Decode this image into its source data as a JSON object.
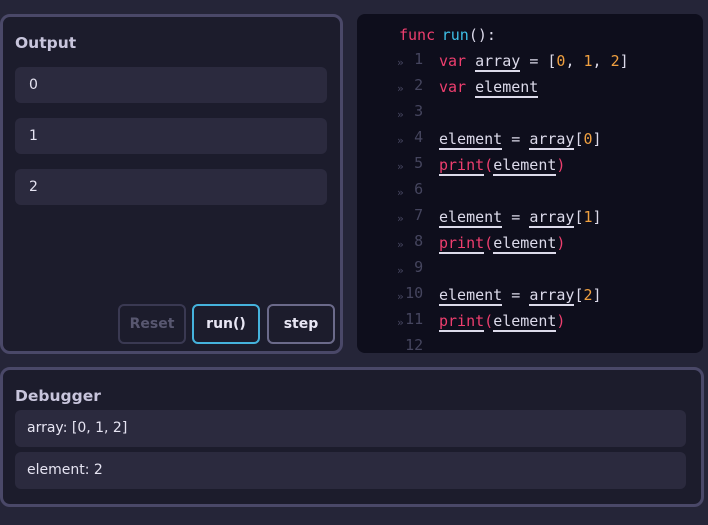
{
  "output_panel": {
    "title": "Output",
    "rows": [
      "0",
      "1",
      "2"
    ],
    "buttons": {
      "reset": "Reset",
      "run": "run()",
      "step": "step"
    }
  },
  "editor": {
    "line_numbers": [
      "1",
      "2",
      "3",
      "4",
      "5",
      "6",
      "7",
      "8",
      "9",
      "10",
      "11",
      "12"
    ],
    "indent_marker": "»",
    "code": {
      "func_kw": "func",
      "func_name": "run",
      "func_tail": "():",
      "var_kw": "var",
      "array_name": "array",
      "element_name": "element",
      "assign": "=",
      "array_open": "[",
      "array_close": "]",
      "comma": ",",
      "print_fn": "print",
      "paren_open": "(",
      "paren_close": ")",
      "num0": "0",
      "num1": "1",
      "num2": "2"
    }
  },
  "debugger_panel": {
    "title": "Debugger",
    "rows": [
      "array: [0, 1, 2]",
      "element: 2"
    ]
  },
  "colors": {
    "keyword": "#ee3e6e",
    "function": "#3ec0e8",
    "number": "#f0a040",
    "run_button_border": "#45b2dc"
  }
}
